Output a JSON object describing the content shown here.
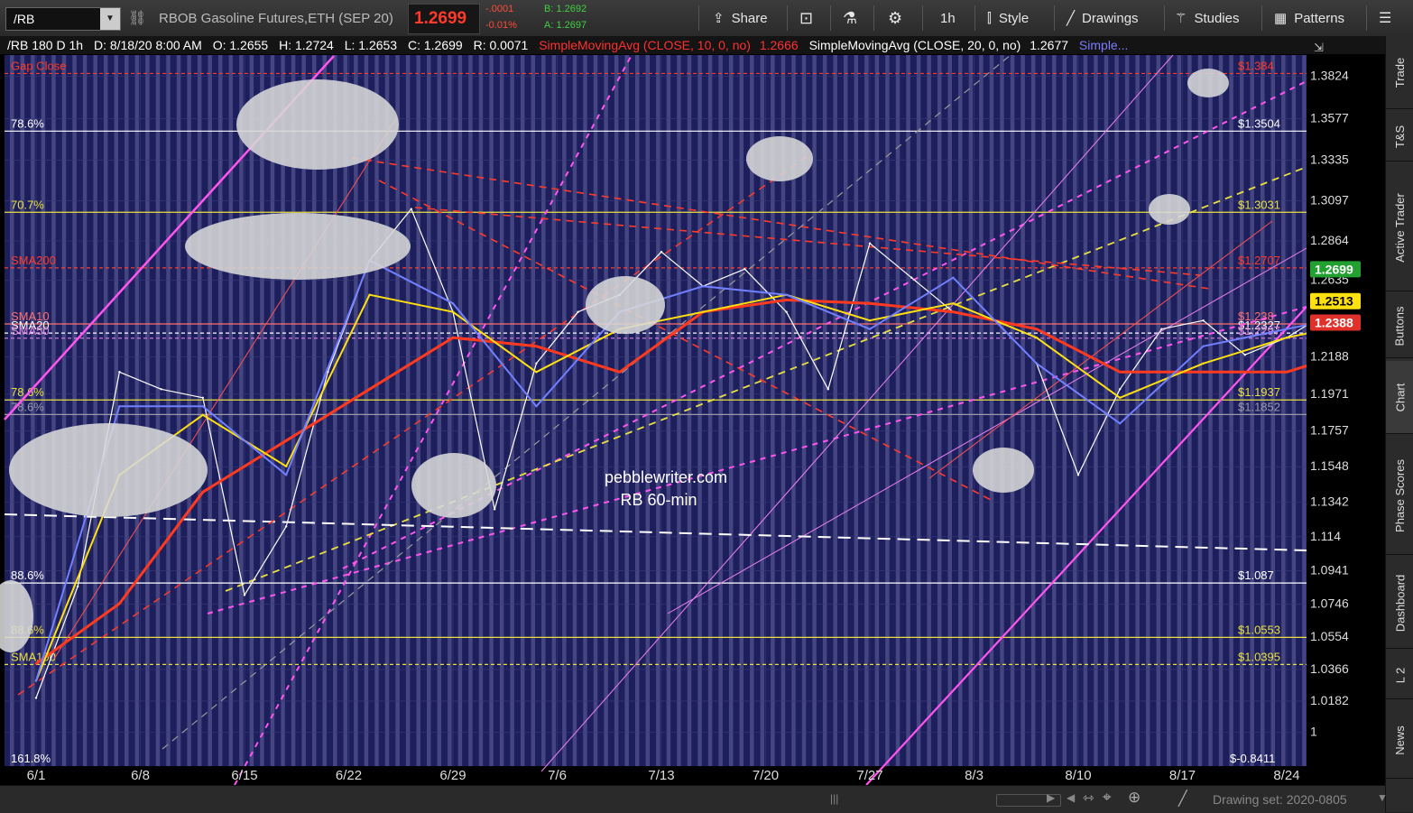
{
  "toolbar": {
    "symbol": "/RB",
    "description": "RBOB Gasoline Futures,ETH (SEP 20)",
    "last": "1.2699",
    "change_abs": "-.0001",
    "change_pct": "-0.01%",
    "bid": "B: 1.2692",
    "ask": "A: 1.2697",
    "share": "Share",
    "timeframe": "1h",
    "style": "Style",
    "drawings": "Drawings",
    "studies": "Studies",
    "patterns": "Patterns"
  },
  "header": {
    "symbol_info": "/RB 180 D 1h",
    "date": "D: 8/18/20 8:00 AM",
    "open": "O: 1.2655",
    "high": "H: 1.2724",
    "low": "L: 1.2653",
    "close": "C: 1.2699",
    "range": "R: 0.0071",
    "sma10": "SimpleMovingAvg (CLOSE, 10, 0, no)",
    "sma10_val": "1.2666",
    "sma20": "SimpleMovingAvg (CLOSE, 20, 0, no)",
    "sma20_val": "1.2677",
    "sma_more": "Simple..."
  },
  "side_tabs": [
    "Trade",
    "T&S",
    "Active Trader",
    "Buttons",
    "Chart",
    "Phase Scores",
    "Dashboard",
    "L 2",
    "News"
  ],
  "bottom": {
    "drawing_set": "Drawing set: 2020-0805"
  },
  "chart_data": {
    "type": "line",
    "ylim": [
      1.0,
      1.3824
    ],
    "y_ticks": [
      "1.3824",
      "1.3577",
      "1.3335",
      "1.3097",
      "1.2864",
      "1.2635",
      "1.2188",
      "1.1971",
      "1.1757",
      "1.1548",
      "1.1342",
      "1.114",
      "1.0941",
      "1.0746",
      "1.0554",
      "1.0366",
      "1.0182",
      "1"
    ],
    "x_ticks": [
      "6/1",
      "6/8",
      "6/15",
      "6/22",
      "6/29",
      "7/6",
      "7/13",
      "7/20",
      "7/27",
      "8/3",
      "8/10",
      "8/17",
      "8/24"
    ],
    "price_badges": [
      {
        "label": "1.2699",
        "value": 1.2699,
        "color": "#22a030"
      },
      {
        "label": "1.2513",
        "value": 1.2513,
        "color": "#ffe010"
      },
      {
        "label": "1.2388",
        "value": 1.2388,
        "color": "#e0302a"
      }
    ],
    "levels": [
      {
        "left": "Gap Close",
        "right": "$1.384",
        "value": 1.384,
        "color": "#ff3a2a",
        "dash": true
      },
      {
        "left": "78.6%",
        "right": "$1.3504",
        "value": 1.3504,
        "color": "#ffffff",
        "dash": false
      },
      {
        "left": "70.7%",
        "right": "$1.3031",
        "value": 1.3031,
        "color": "#e8e040",
        "dash": false
      },
      {
        "left": "SMA200",
        "right": "$1.2707",
        "value": 1.2707,
        "color": "#ff3a2a",
        "dash": true
      },
      {
        "left": "SMA10",
        "right": "$1.238",
        "value": 1.238,
        "color": "#ff7070",
        "dash": false
      },
      {
        "left": "SMA20",
        "right": "$1.2327",
        "value": 1.2327,
        "color": "#ffffff",
        "dash": true
      },
      {
        "left": "SMA50",
        "right": "$1.2297",
        "value": 1.2297,
        "color": "#e080e0",
        "dash": true
      },
      {
        "left": "78.6%",
        "right": "$1.1937",
        "value": 1.1937,
        "color": "#e8e040",
        "dash": false
      },
      {
        "left": "78.6%",
        "right": "$1.1852",
        "value": 1.1852,
        "color": "#9a9aa8",
        "dash": false
      },
      {
        "left": "88.6%",
        "right": "$1.087",
        "value": 1.087,
        "color": "#ffffff",
        "dash": false
      },
      {
        "left": "88.6%",
        "right": "$1.0553",
        "value": 1.0553,
        "color": "#e8e040",
        "dash": false
      },
      {
        "left": "SMA100",
        "right": "$1.0395",
        "value": 1.0395,
        "color": "#e8e040",
        "dash": true
      },
      {
        "left": "161.8%",
        "right": "$-0.8411",
        "value": null,
        "color": "#ffffff",
        "dash": false
      }
    ],
    "watermark": [
      "pebblewriter.com",
      "RB 60-min"
    ],
    "series": [
      {
        "name": "Price",
        "color": "#ffffff",
        "x": [
          0,
          2,
          4,
          6,
          8,
          10,
          12,
          14,
          16,
          18,
          20,
          22,
          24,
          26,
          28,
          30,
          32,
          34,
          36,
          38,
          40,
          42,
          44,
          46,
          48,
          50,
          52,
          54,
          56,
          58,
          60,
          62,
          64,
          66,
          68,
          70,
          72,
          74,
          76,
          78,
          80
        ],
        "values": [
          1.02,
          1.085,
          1.21,
          1.2,
          1.195,
          1.08,
          1.12,
          1.21,
          1.275,
          1.305,
          1.245,
          1.13,
          1.215,
          1.245,
          1.255,
          1.28,
          1.26,
          1.27,
          1.245,
          1.2,
          1.285,
          1.265,
          1.245,
          1.24,
          1.215,
          1.15,
          1.2,
          1.235,
          1.24,
          1.22,
          1.23,
          1.245,
          1.24,
          1.28,
          1.268,
          1.27,
          1.268,
          1.269,
          1.27,
          1.27,
          1.27
        ]
      },
      {
        "name": "SMA200",
        "color": "#ff3a1e",
        "x": [
          0,
          4,
          8,
          12,
          16,
          20,
          24,
          28,
          32,
          36,
          40,
          44,
          48,
          52,
          56,
          60,
          64,
          68
        ],
        "values": [
          1.04,
          1.075,
          1.14,
          1.17,
          1.2,
          1.23,
          1.225,
          1.21,
          1.245,
          1.252,
          1.25,
          1.245,
          1.235,
          1.21,
          1.21,
          1.21,
          1.225,
          1.24
        ]
      },
      {
        "name": "SMA50",
        "color": "#ffe010",
        "x": [
          0,
          4,
          8,
          12,
          16,
          20,
          24,
          28,
          32,
          36,
          40,
          44,
          48,
          52,
          56,
          60,
          64,
          68
        ],
        "values": [
          1.03,
          1.15,
          1.185,
          1.155,
          1.255,
          1.245,
          1.21,
          1.235,
          1.245,
          1.255,
          1.24,
          1.25,
          1.23,
          1.195,
          1.215,
          1.23,
          1.24,
          1.251
        ]
      },
      {
        "name": "SMA20",
        "color": "#7080ff",
        "x": [
          0,
          4,
          8,
          12,
          16,
          20,
          24,
          28,
          32,
          36,
          40,
          44,
          48,
          52,
          56,
          60,
          64,
          68
        ],
        "values": [
          1.03,
          1.19,
          1.19,
          1.15,
          1.275,
          1.25,
          1.19,
          1.245,
          1.26,
          1.255,
          1.235,
          1.265,
          1.215,
          1.18,
          1.225,
          1.235,
          1.245,
          1.265
        ]
      }
    ],
    "grid": true
  }
}
